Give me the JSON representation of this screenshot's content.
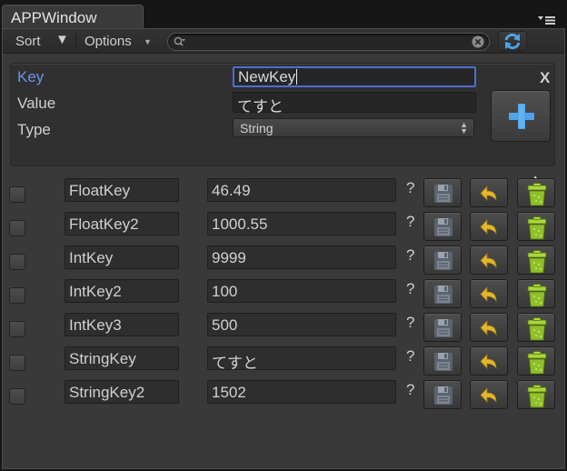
{
  "window": {
    "title": "APPWindow"
  },
  "toolbar": {
    "sort_label": "Sort",
    "sort_arrow": "▼",
    "options_label": "Options",
    "search_value": ""
  },
  "new_entry": {
    "key_label": "Key",
    "key_value": "NewKey",
    "value_label": "Value",
    "value_value": "てすと",
    "type_label": "Type",
    "type_selected": "String",
    "close_label": "X"
  },
  "rows": [
    {
      "key": "FloatKey",
      "value": "46.49",
      "help": "?"
    },
    {
      "key": "FloatKey2",
      "value": "1000.55",
      "help": "?"
    },
    {
      "key": "IntKey",
      "value": "9999",
      "help": "?"
    },
    {
      "key": "IntKey2",
      "value": "100",
      "help": "?"
    },
    {
      "key": "IntKey3",
      "value": "500",
      "help": "?"
    },
    {
      "key": "StringKey",
      "value": "てすと",
      "help": "?"
    },
    {
      "key": "StringKey2",
      "value": "1502",
      "help": "?"
    }
  ],
  "colors": {
    "accent_blue": "#6a93e8",
    "add_plus": "#4fa3e8",
    "revert_yellow": "#e3b62c",
    "delete_green": "#8fc02a"
  },
  "icons": {
    "refresh": "refresh-icon",
    "add": "plus-icon",
    "save": "floppy-disk-icon",
    "revert": "undo-arrow-icon",
    "delete": "trash-can-icon"
  }
}
